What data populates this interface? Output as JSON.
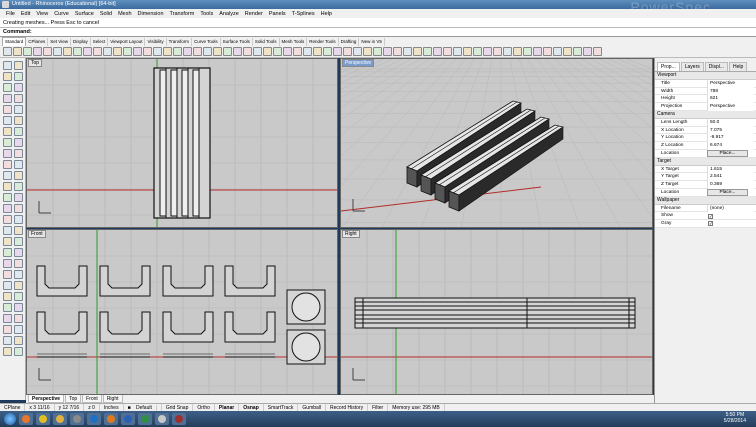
{
  "window": {
    "title": "Untitled - Rhinoceros (Educational) [64-bit]",
    "watermark": "PowerSpec"
  },
  "menu": [
    "File",
    "Edit",
    "View",
    "Curve",
    "Surface",
    "Solid",
    "Mesh",
    "Dimension",
    "Transform",
    "Tools",
    "Analyze",
    "Render",
    "Panels",
    "T-Splines",
    "Help"
  ],
  "command": {
    "history": "Creating meshes... Press Esc to cancel",
    "prompt": "Command:"
  },
  "toolbar_tabs": [
    "Standard",
    "CPlanes",
    "Set View",
    "Display",
    "Select",
    "Viewport Layout",
    "Visibility",
    "Transform",
    "Curve Tools",
    "Surface Tools",
    "Solid Tools",
    "Mesh Tools",
    "Render Tools",
    "Drafting",
    "New in V5"
  ],
  "viewports": {
    "top": "Top",
    "perspective": "Perspective",
    "front": "Front",
    "right": "Right"
  },
  "viewport_tabs": [
    "Perspective",
    "Top",
    "Front",
    "Right"
  ],
  "panel": {
    "tabs": [
      "Prop...",
      "Layers",
      "Displ...",
      "Help"
    ],
    "sections": {
      "viewport": "Viewport",
      "camera": "Camera",
      "target": "Target",
      "wallpaper": "Wallpaper"
    },
    "viewport_rows": [
      {
        "key": "Title",
        "value": "Perspective"
      },
      {
        "key": "Width",
        "value": "788"
      },
      {
        "key": "Height",
        "value": "621"
      },
      {
        "key": "Projection",
        "value": "Perspective"
      }
    ],
    "camera_rows": [
      {
        "key": "Lens Length",
        "value": "50.0"
      },
      {
        "key": "X Location",
        "value": "7.075"
      },
      {
        "key": "Y Location",
        "value": "-9.917"
      },
      {
        "key": "Z Location",
        "value": "6.674"
      },
      {
        "key": "Location",
        "button": "Place..."
      }
    ],
    "target_rows": [
      {
        "key": "X Target",
        "value": "1.615"
      },
      {
        "key": "Y Target",
        "value": "2.541"
      },
      {
        "key": "Z Target",
        "value": "0.369"
      },
      {
        "key": "Location",
        "button": "Place..."
      }
    ],
    "wallpaper_rows": [
      {
        "key": "Filename",
        "value": "(none)"
      },
      {
        "key": "Show",
        "check": "✓"
      },
      {
        "key": "Gray",
        "check": "✓"
      }
    ]
  },
  "status": {
    "cplane": "CPlane",
    "x": "x 3 11/16",
    "y": "y 12 7/16",
    "z": "z 0",
    "units": "Inches",
    "layer": "Default",
    "toggles": [
      "Grid Snap",
      "Ortho",
      "Planar",
      "Osnap",
      "SmartTrack",
      "Gumball",
      "Record History",
      "Filter"
    ],
    "memory": "Memory use: 295 MB"
  },
  "clock": {
    "time": "5:50 PM",
    "date": "5/28/2014"
  },
  "colors": {
    "viewport_bg": "#c9c9c9",
    "grid": "#b4b4b4",
    "axis_x": "#b52a2a",
    "axis_y": "#2c9a2c",
    "taskbar": "#2f4d70"
  },
  "icons": [
    "rhino-app-icon",
    "start-orb-icon",
    "ie-icon",
    "firefox-icon",
    "chrome-icon",
    "folder-icon",
    "media-icon",
    "photoshop-icon",
    "illustrator-icon",
    "word-icon",
    "excel-icon",
    "rhino-taskbar-icon"
  ]
}
